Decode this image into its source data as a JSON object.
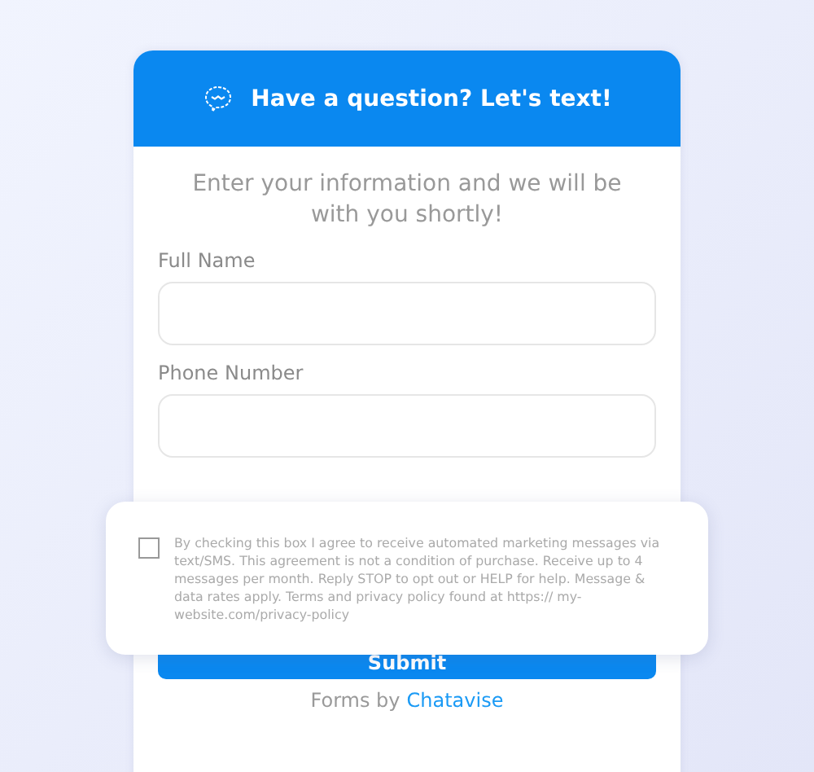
{
  "header": {
    "title": "Have a question? Let's text!"
  },
  "subtitle": "Enter your information and we will be with you shortly!",
  "fields": [
    {
      "label": "Full Name"
    },
    {
      "label": "Phone Number"
    }
  ],
  "consent": {
    "checked": false,
    "text": "By checking this box I agree to receive automated marketing messages via text/SMS. This agreement is not a condition of purchase. Receive up to 4 messages per month. Reply STOP to opt out or HELP for help. Message & data rates apply. Terms and privacy policy found at https:// my-website.com/privacy-policy"
  },
  "submit": {
    "label": "Submit"
  },
  "footer": {
    "prefix": "Forms by",
    "link": "Chatavise"
  }
}
